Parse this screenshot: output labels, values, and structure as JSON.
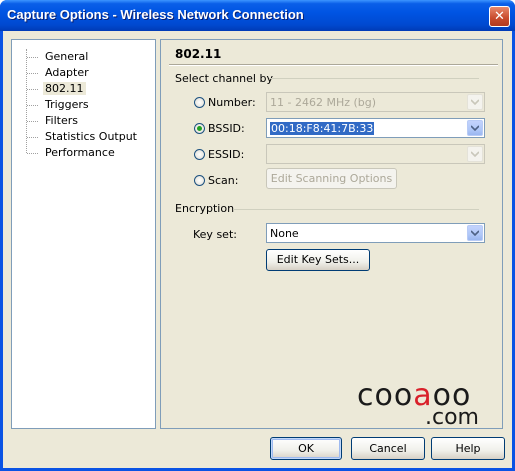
{
  "window": {
    "title": "Capture Options - Wireless Network Connection",
    "close_glyph": "✕"
  },
  "nav": {
    "items": [
      {
        "label": "General"
      },
      {
        "label": "Adapter"
      },
      {
        "label": "802.11",
        "selected": true
      },
      {
        "label": "Triggers"
      },
      {
        "label": "Filters"
      },
      {
        "label": "Statistics Output"
      },
      {
        "label": "Performance"
      }
    ]
  },
  "page": {
    "title": "802.11",
    "channel": {
      "group_label": "Select channel by",
      "number": {
        "label": "Number:",
        "value": "11 - 2462 MHz (bg)",
        "checked": false,
        "enabled": false
      },
      "bssid": {
        "label": "BSSID:",
        "value": "00:18:F8:41:7B:33",
        "checked": true,
        "enabled": true
      },
      "essid": {
        "label": "ESSID:",
        "value": "",
        "checked": false,
        "enabled": false
      },
      "scan": {
        "label": "Scan:",
        "button_label": "Edit Scanning Options",
        "checked": false,
        "enabled": false
      }
    },
    "encryption": {
      "group_label": "Encryption",
      "key_set_label": "Key set:",
      "key_set_value": "None",
      "edit_button_label": "Edit Key Sets..."
    }
  },
  "footer": {
    "ok": "OK",
    "cancel": "Cancel",
    "help": "Help"
  },
  "watermark": {
    "word_a": "coo",
    "word_b": "a",
    "word_c": "oo",
    "domain": ".com",
    "accent": "#d9202a"
  },
  "colors": {
    "titlebar": "#0054e3",
    "dialog_bg": "#ece9d8",
    "selection": "#316ac5",
    "radio_dot": "#21a121"
  }
}
